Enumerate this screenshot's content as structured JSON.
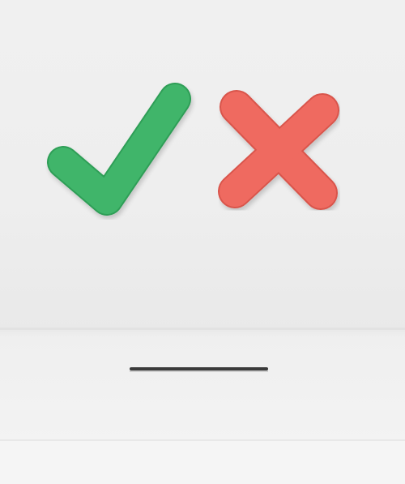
{
  "scene": {
    "description_icons": [
      "check-mark-icon",
      "x-mark-icon"
    ],
    "colors": {
      "wall": "#eeeeee",
      "wall_shadow": "#e6e6e6",
      "box_top": "#ececec",
      "box_front": "#f2f2f2",
      "box_bottom_band": "#f6f6f6",
      "check_green": "#3fb56a",
      "check_green_edge": "#2f9e57",
      "x_red": "#ef6a60",
      "x_red_edge": "#d9554c",
      "slot": "#3a3a3a"
    }
  }
}
